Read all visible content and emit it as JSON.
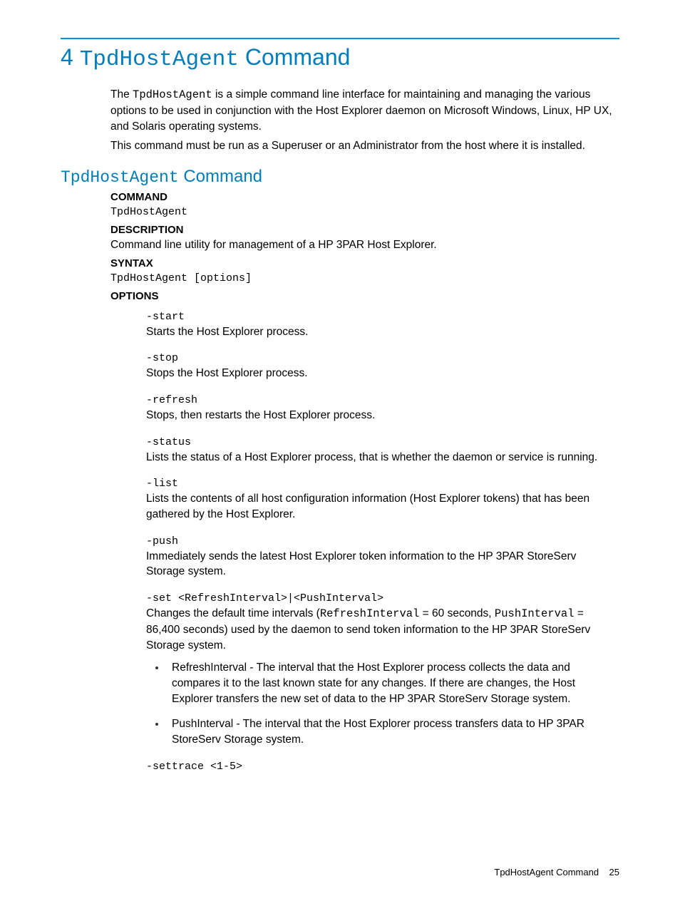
{
  "chapter": {
    "num": "4",
    "cmd": "TpdHostAgent",
    "word": "Command"
  },
  "intro": {
    "p1a": "The ",
    "p1cmd": "TpdHostAgent",
    "p1b": " is a simple command line interface for maintaining and managing the various options to be used in conjunction with the Host Explorer daemon on Microsoft Windows, Linux, HP UX, and Solaris operating systems.",
    "p2": "This command must be run as a Superuser or an Administrator from the host where it is installed."
  },
  "section": {
    "cmd": "TpdHostAgent",
    "word": "Command"
  },
  "labels": {
    "command": "COMMAND",
    "description": "DESCRIPTION",
    "syntax": "SYNTAX",
    "options": "OPTIONS"
  },
  "command_value": "TpdHostAgent",
  "description_value": "Command line utility for management of a HP 3PAR Host Explorer.",
  "syntax_value": "TpdHostAgent [options]",
  "options": [
    {
      "flag": "-start",
      "desc": "Starts the Host Explorer process."
    },
    {
      "flag": "-stop",
      "desc": "Stops the Host Explorer process."
    },
    {
      "flag": "-refresh",
      "desc": "Stops, then restarts the Host Explorer process."
    },
    {
      "flag": "-status",
      "desc": "Lists the status of a Host Explorer process, that is whether the daemon or service is running."
    },
    {
      "flag": "-list",
      "desc": "Lists the contents of all host configuration information (Host Explorer tokens) that has been gathered by the Host Explorer."
    },
    {
      "flag": "-push",
      "desc": "Immediately sends the latest Host Explorer token information to the HP 3PAR StoreServ Storage system."
    }
  ],
  "set_opt": {
    "flag": "-set <RefreshInterval>|<PushInterval>",
    "pre1": "Changes the default time intervals (",
    "m1": "RefreshInterval",
    "mid1": " = 60 seconds, ",
    "m2": "PushInterval",
    "post1": " = 86,400 seconds) used by the daemon to send token information to the HP 3PAR StoreServ Storage system.",
    "bullets": [
      "RefreshInterval - The interval that the Host Explorer process collects the data and compares it to the last known state for any changes. If there are changes, the Host Explorer transfers the new set of data to the HP 3PAR StoreServ Storage system.",
      "PushInterval - The interval that the Host Explorer process transfers data to HP 3PAR StoreServ Storage system."
    ]
  },
  "settrace_flag": "-settrace <1-5>",
  "footer": {
    "text": "TpdHostAgent Command",
    "page": "25"
  }
}
